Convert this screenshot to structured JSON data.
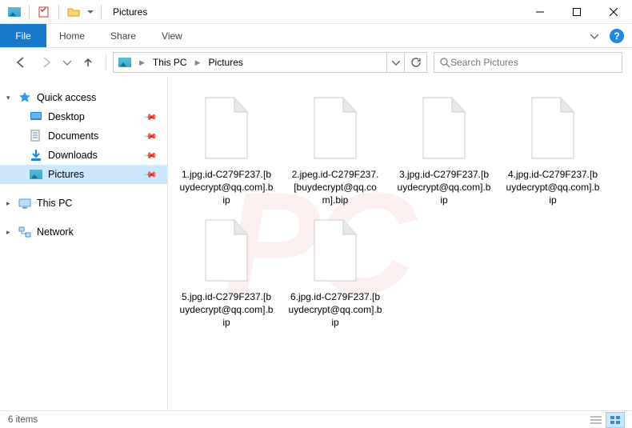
{
  "titlebar": {
    "title": "Pictures"
  },
  "ribbon": {
    "file": "File",
    "tabs": [
      "Home",
      "Share",
      "View"
    ]
  },
  "breadcrumb": {
    "items": [
      "This PC",
      "Pictures"
    ]
  },
  "search": {
    "placeholder": "Search Pictures"
  },
  "nav": {
    "quick_access": "Quick access",
    "items": [
      {
        "label": "Desktop",
        "pinned": true,
        "icon": "desktop"
      },
      {
        "label": "Documents",
        "pinned": true,
        "icon": "documents"
      },
      {
        "label": "Downloads",
        "pinned": true,
        "icon": "downloads"
      },
      {
        "label": "Pictures",
        "pinned": true,
        "icon": "pictures",
        "selected": true
      }
    ],
    "this_pc": "This PC",
    "network": "Network"
  },
  "files": [
    {
      "name": "1.jpg.id-C279F237.[buydecrypt@qq.com].bip"
    },
    {
      "name": "2.jpeg.id-C279F237.[buydecrypt@qq.com].bip"
    },
    {
      "name": "3.jpg.id-C279F237.[buydecrypt@qq.com].bip"
    },
    {
      "name": "4.jpg.id-C279F237.[buydecrypt@qq.com].bip"
    },
    {
      "name": "5.jpg.id-C279F237.[buydecrypt@qq.com].bip"
    },
    {
      "name": "6.jpg.id-C279F237.[buydecrypt@qq.com].bip"
    }
  ],
  "status": {
    "count_label": "6 items"
  }
}
